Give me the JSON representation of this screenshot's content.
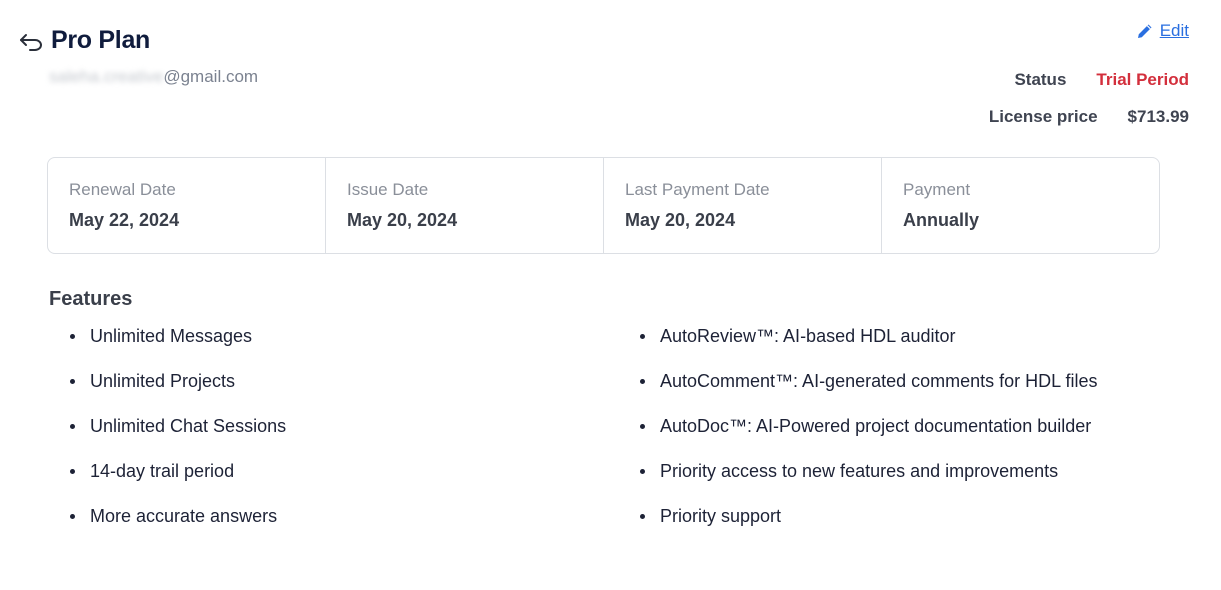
{
  "header": {
    "title": "Pro Plan",
    "email_hidden": "saleha.creative",
    "email_domain": "@gmail.com",
    "edit_label": "Edit"
  },
  "meta": {
    "status_label": "Status",
    "status_value": "Trial Period",
    "price_label": "License price",
    "price_value": "$713.99"
  },
  "cards": [
    {
      "label": "Renewal Date",
      "value": "May 22, 2024"
    },
    {
      "label": "Issue Date",
      "value": "May 20, 2024"
    },
    {
      "label": "Last Payment Date",
      "value": "May 20, 2024"
    },
    {
      "label": "Payment",
      "value": "Annually"
    }
  ],
  "features": {
    "heading": "Features",
    "left": [
      "Unlimited Messages",
      "Unlimited Projects",
      "Unlimited Chat Sessions",
      "14-day trail period",
      "More accurate answers"
    ],
    "right": [
      "AutoReview™: AI-based HDL auditor",
      "AutoComment™: AI-generated comments for HDL files",
      "AutoDoc™: AI-Powered project documentation builder",
      "Priority access to new features and improvements",
      "Priority support"
    ]
  },
  "colors": {
    "accent": "#2a6fe0",
    "status": "#d32f3c",
    "title": "#101c3d"
  },
  "icons": [
    "back-arrow-icon",
    "pencil-icon"
  ]
}
